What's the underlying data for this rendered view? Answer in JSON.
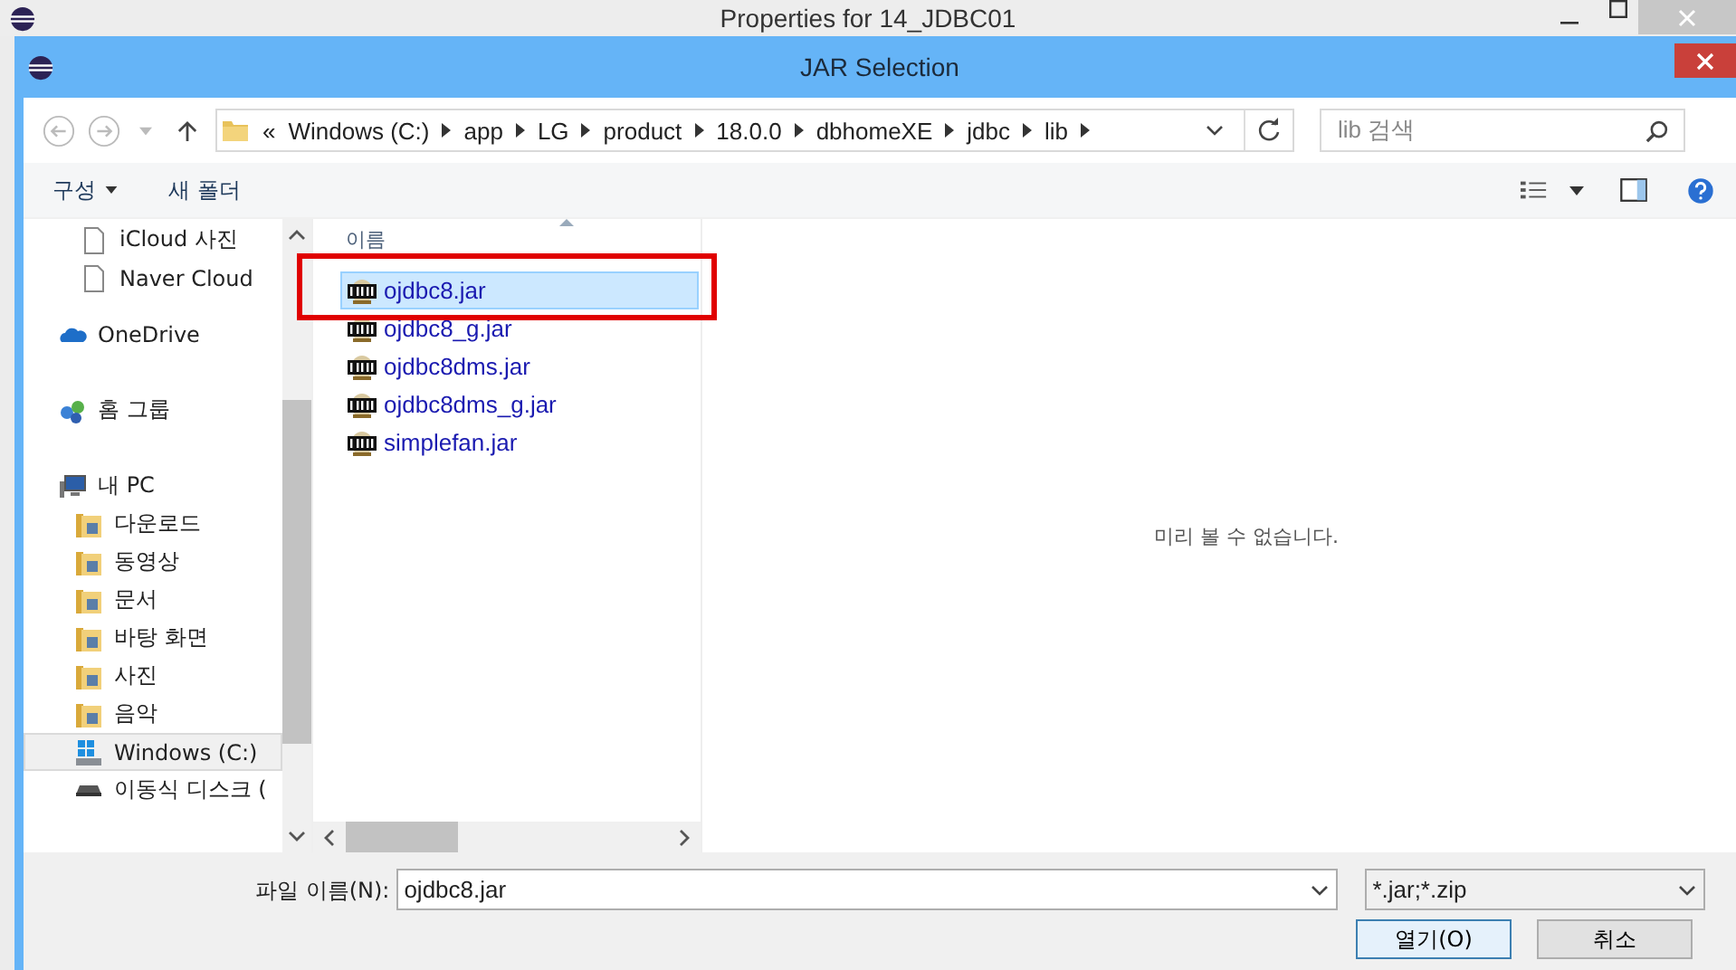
{
  "outer_window": {
    "title": "Properties for 14_JDBC01"
  },
  "dialog": {
    "title": "JAR Selection"
  },
  "address_bar": {
    "overflow": "«",
    "segments": [
      "Windows (C:)",
      "app",
      "LG",
      "product",
      "18.0.0",
      "dbhomeXE",
      "jdbc",
      "lib"
    ]
  },
  "search": {
    "placeholder": "lib 검색"
  },
  "toolbar": {
    "organize": "구성",
    "new_folder": "새 폴더"
  },
  "sidebar": {
    "items": [
      {
        "label": "iCloud 사진",
        "kind": "file",
        "selected": false
      },
      {
        "label": "Naver Cloud",
        "kind": "file",
        "selected": false
      },
      {
        "label": "OneDrive",
        "kind": "cloud",
        "selected": false
      },
      {
        "label": "홈 그룹",
        "kind": "homegroup",
        "selected": false
      },
      {
        "label": "내 PC",
        "kind": "pc",
        "selected": false,
        "children": [
          {
            "label": "다운로드",
            "kind": "folder",
            "selected": false
          },
          {
            "label": "동영상",
            "kind": "folder",
            "selected": false
          },
          {
            "label": "문서",
            "kind": "folder",
            "selected": false
          },
          {
            "label": "바탕 화면",
            "kind": "folder",
            "selected": false
          },
          {
            "label": "사진",
            "kind": "folder",
            "selected": false
          },
          {
            "label": "음악",
            "kind": "folder",
            "selected": false
          },
          {
            "label": "Windows (C:)",
            "kind": "drive",
            "selected": true
          },
          {
            "label": "이동식 디스크 (",
            "kind": "removable",
            "selected": false
          }
        ]
      }
    ]
  },
  "file_list": {
    "column": "이름",
    "files": [
      {
        "name": "ojdbc8.jar",
        "selected": true
      },
      {
        "name": "ojdbc8_g.jar",
        "selected": false
      },
      {
        "name": "ojdbc8dms.jar",
        "selected": false
      },
      {
        "name": "ojdbc8dms_g.jar",
        "selected": false
      },
      {
        "name": "simplefan.jar",
        "selected": false
      }
    ]
  },
  "preview": {
    "message": "미리 볼 수 없습니다."
  },
  "footer": {
    "file_name_label": "파일 이름(N):",
    "file_name": "ojdbc8.jar",
    "filter": "*.jar;*.zip",
    "buttons": [
      "열기(O)",
      "취소"
    ]
  }
}
